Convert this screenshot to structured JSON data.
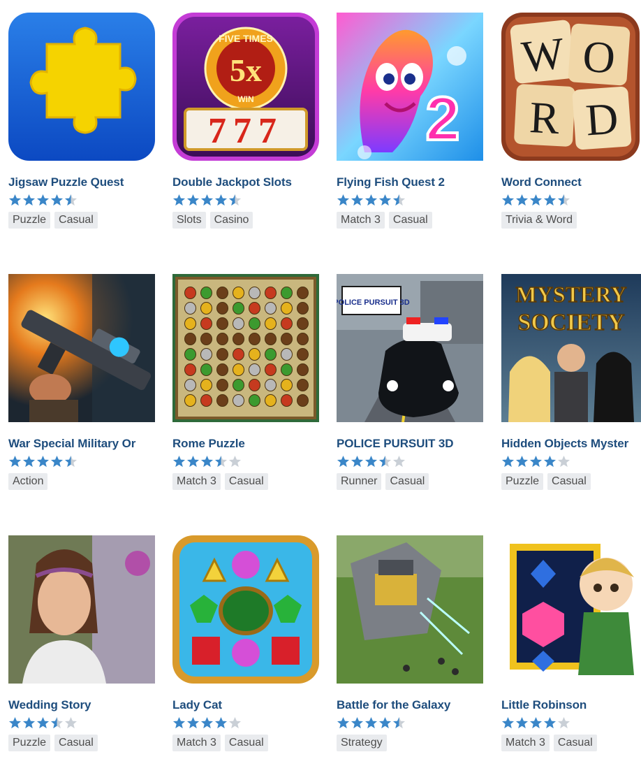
{
  "colors": {
    "title": "#1e4d7d",
    "star_filled": "#3a86c8",
    "star_empty": "#c9cfd6",
    "tag_bg": "#e9ebee",
    "tag_text": "#4d4d4d"
  },
  "games": [
    {
      "title": "Jigsaw Puzzle Quest",
      "rating": 4.5,
      "tags": [
        "Puzzle",
        "Casual"
      ],
      "icon": "puzzle-piece-icon"
    },
    {
      "title": "Double Jackpot Slots",
      "rating": 4.5,
      "tags": [
        "Slots",
        "Casino"
      ],
      "icon": "slot-machine-icon",
      "icon_text": {
        "top": "FIVE TIMES",
        "big": "5x",
        "bottom": "WIN",
        "reels": "777"
      }
    },
    {
      "title": "Flying Fish Quest 2",
      "rating": 4.5,
      "tags": [
        "Match 3",
        "Casual"
      ],
      "icon": "fish-icon",
      "icon_text": {
        "big": "2"
      }
    },
    {
      "title": "Word Connect",
      "rating": 4.5,
      "tags": [
        "Trivia & Word"
      ],
      "icon": "letter-tiles-icon",
      "icon_text": {
        "letters": [
          "W",
          "O",
          "R",
          "D"
        ]
      }
    },
    {
      "title": "War Special Military Or",
      "rating": 4.5,
      "tags": [
        "Action"
      ],
      "icon": "rifle-icon"
    },
    {
      "title": "Rome Puzzle",
      "rating": 3.5,
      "tags": [
        "Match 3",
        "Casual"
      ],
      "icon": "gem-board-icon"
    },
    {
      "title": "POLICE PURSUIT 3D",
      "rating": 3.5,
      "tags": [
        "Runner",
        "Casual"
      ],
      "icon": "police-car-icon",
      "icon_text": {
        "logo": "POLICE PURSUIT 3D"
      }
    },
    {
      "title": "Hidden Objects Myster",
      "rating": 4,
      "tags": [
        "Puzzle",
        "Casual"
      ],
      "icon": "mystery-characters-icon",
      "icon_text": {
        "line1": "MYSTERY",
        "line2": "SOCIETY"
      }
    },
    {
      "title": "Wedding Story",
      "rating": 3.5,
      "tags": [
        "Puzzle",
        "Casual"
      ],
      "icon": "bride-portrait-icon"
    },
    {
      "title": "Lady Cat",
      "rating": 4,
      "tags": [
        "Match 3",
        "Casual"
      ],
      "icon": "jewels-icon"
    },
    {
      "title": "Battle for the Galaxy",
      "rating": 4.5,
      "tags": [
        "Strategy"
      ],
      "icon": "battle-base-icon"
    },
    {
      "title": "Little Robinson",
      "rating": 4,
      "tags": [
        "Match 3",
        "Casual"
      ],
      "icon": "boy-gems-icon"
    }
  ]
}
